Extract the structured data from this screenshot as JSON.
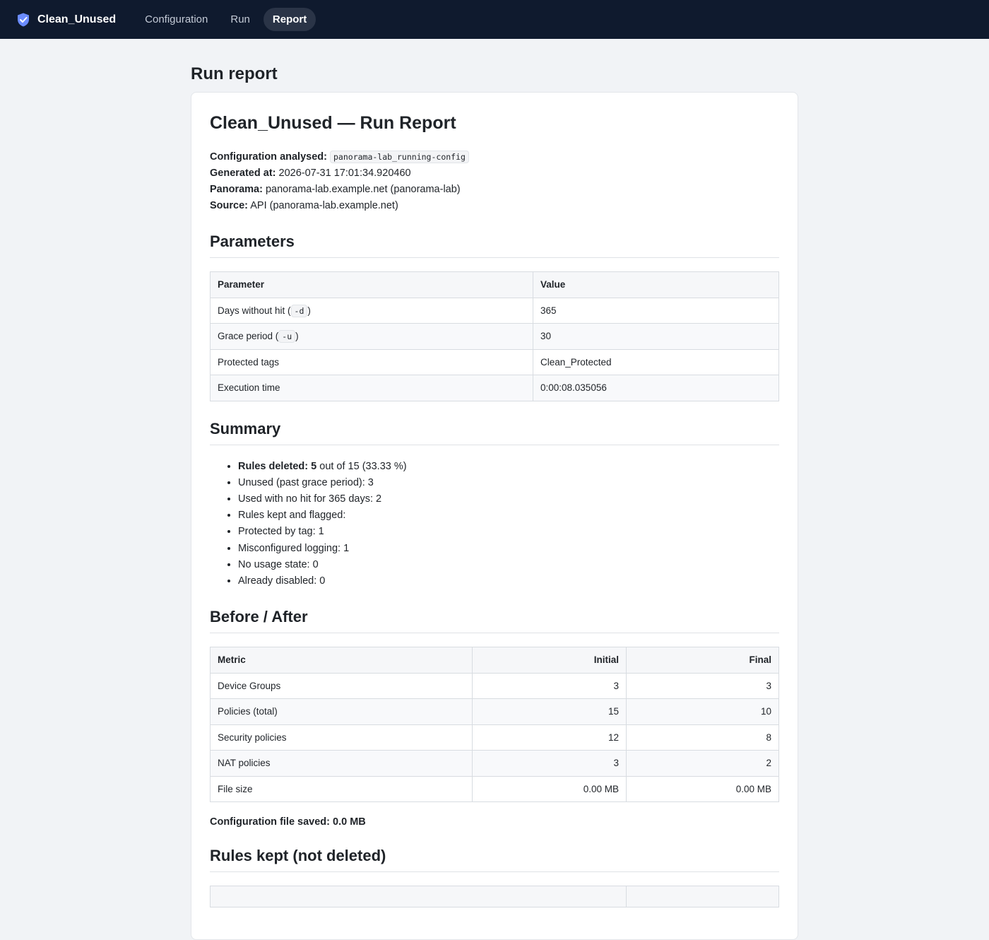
{
  "app": {
    "name": "Clean_Unused",
    "nav": [
      {
        "label": "Configuration",
        "active": false
      },
      {
        "label": "Run",
        "active": false
      },
      {
        "label": "Report",
        "active": true
      }
    ]
  },
  "page": {
    "title": "Run report"
  },
  "report": {
    "title": "Clean_Unused — Run Report",
    "meta": {
      "config_label": "Configuration analysed:",
      "config_value": "panorama-lab_running-config",
      "generated_label": "Generated at:",
      "generated_value": "2026-07-31 17:01:34.920460",
      "panorama_label": "Panorama:",
      "panorama_value": "panorama-lab.example.net (panorama-lab)",
      "source_label": "Source:",
      "source_value": "API (panorama-lab.example.net)"
    },
    "parameters": {
      "heading": "Parameters",
      "col_parameter": "Parameter",
      "col_value": "Value",
      "rows": [
        {
          "pre": "Days without hit (",
          "code": "-d",
          "post": ")",
          "value": "365"
        },
        {
          "pre": "Grace period (",
          "code": "-u",
          "post": ")",
          "value": "30"
        },
        {
          "pre": "Protected tags",
          "code": "",
          "post": "",
          "value": "Clean_Protected"
        },
        {
          "pre": "Execution time",
          "code": "",
          "post": "",
          "value": "0:00:08.035056"
        }
      ]
    },
    "summary": {
      "heading": "Summary",
      "deleted_label": "Rules deleted:",
      "deleted_count": "5",
      "deleted_rest": "out of 15 (33.33 %)",
      "items": [
        "Unused (past grace period): 3",
        "Used with no hit for 365 days: 2",
        "Rules kept and flagged:",
        "Protected by tag: 1",
        "Misconfigured logging: 1",
        "No usage state: 0",
        "Already disabled: 0"
      ]
    },
    "before_after": {
      "heading": "Before / After",
      "col_metric": "Metric",
      "col_initial": "Initial",
      "col_final": "Final",
      "rows": [
        {
          "metric": "Device Groups",
          "initial": "3",
          "final": "3"
        },
        {
          "metric": "Policies (total)",
          "initial": "15",
          "final": "10"
        },
        {
          "metric": "Security policies",
          "initial": "12",
          "final": "8"
        },
        {
          "metric": "NAT policies",
          "initial": "3",
          "final": "2"
        },
        {
          "metric": "File size",
          "initial": "0.00 MB",
          "final": "0.00 MB"
        }
      ],
      "saved": "Configuration file saved: 0.0 MB"
    },
    "kept": {
      "heading": "Rules kept (not deleted)"
    }
  }
}
